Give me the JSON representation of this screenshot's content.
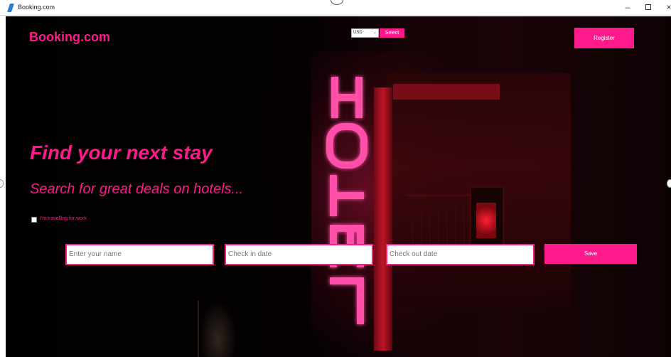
{
  "window": {
    "title": "Booking.com",
    "minimize_glyph": "–",
    "close_glyph": "×"
  },
  "header": {
    "brand": "Booking.com",
    "currency_value": "USD",
    "currency_select_label": "Select",
    "register_label": "Register"
  },
  "hero": {
    "headline": "Find your next stay",
    "subheadline": "Search for great deals on hotels...",
    "sign_text": "HOTEL"
  },
  "form": {
    "work_travel_label": "I'm travelling for work",
    "name_placeholder": "Enter your name",
    "checkin_placeholder": "Check in date",
    "checkout_placeholder": "Check out date",
    "save_label": "Save"
  },
  "colors": {
    "accent": "#ff1a8c",
    "background": "#050103"
  }
}
